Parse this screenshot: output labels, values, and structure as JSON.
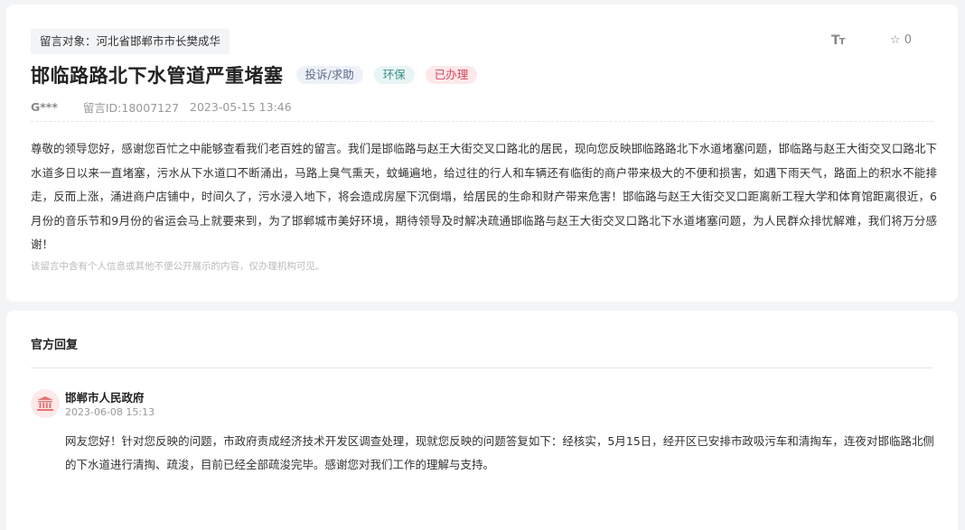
{
  "message": {
    "target_label": "留言对象：河北省邯郸市市长樊成华",
    "title": "邯临路路北下水管道严重堵塞",
    "badges": {
      "type": "投诉/求助",
      "category": "环保",
      "status": "已办理"
    },
    "author": "G***",
    "message_id": "留言ID:18007127",
    "datetime": "2023-05-15 13:46",
    "font_tool_icon": "text-size-icon",
    "favorite_count": "0",
    "content": "尊敬的领导您好，感谢您百忙之中能够查看我们老百姓的留言。我们是邯临路与赵王大街交叉口路北的居民，现向您反映邯临路路北下水道堵塞问题，邯临路与赵王大街交叉口路北下水道多日以来一直堵塞，污水从下水道口不断涌出，马路上臭气熏天，蚊蝇遍地，给过往的行人和车辆还有临街的商户带来极大的不便和损害，如遇下雨天气，路面上的积水不能排走，反而上涨，涌进商户店铺中，时间久了，污水浸入地下，将会造成房屋下沉倒塌，给居民的生命和财产带来危害！邯临路与赵王大街交叉口距离新工程大学和体育馆距离很近，6月份的音乐节和9月份的省运会马上就要来到，为了邯郸城市美好环境，期待领导及时解决疏通邯临路与赵王大街交叉口路北下水道堵塞问题，为人民群众排忧解难，我们将万分感谢！",
    "privacy_note": "该留言中含有个人信息或其他不便公开展示的内容，仅办理机构可见。"
  },
  "reply": {
    "section_title": "官方回复",
    "org_icon": "government-building-icon",
    "org_name": "邯郸市人民政府",
    "datetime": "2023-06-08 15:13",
    "content": "网友您好！针对您反映的问题，市政府责成经济技术开发区调查处理，现就您反映的问题答复如下：经核实，5月15日，经开区已安排市政吸污车和清掏车，连夜对邯临路北侧的下水道进行清掏、疏浚，目前已经全部疏浚完毕。感谢您对我们工作的理解与支持。"
  },
  "colors": {
    "status_done": "#d6455a",
    "category_env": "#3a8f8a",
    "type_badge": "#5a6b8c"
  }
}
